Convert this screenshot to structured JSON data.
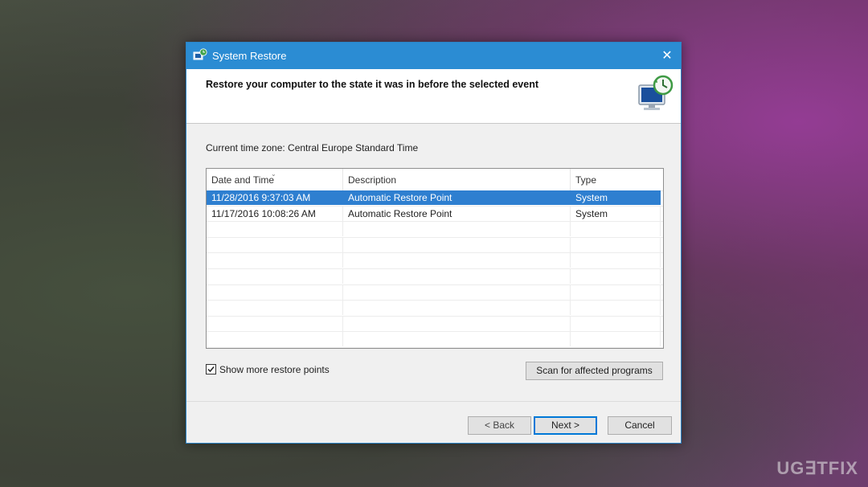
{
  "window": {
    "title": "System Restore",
    "close_glyph": "✕",
    "icon": "system-restore-icon"
  },
  "header": {
    "text": "Restore your computer to the state it was in before the selected event",
    "icon": "computer-restore-icon"
  },
  "timezone_label": "Current time zone: Central Europe Standard Time",
  "table": {
    "columns": [
      "Date and Time",
      "Description",
      "Type"
    ],
    "rows": [
      {
        "date": "11/28/2016 9:37:03 AM",
        "description": "Automatic Restore Point",
        "type": "System",
        "selected": true
      },
      {
        "date": "11/17/2016 10:08:26 AM",
        "description": "Automatic Restore Point",
        "type": "System",
        "selected": false
      }
    ]
  },
  "show_more": {
    "label": "Show more restore points",
    "checked": true
  },
  "buttons": {
    "scan": "Scan for affected programs",
    "back": "< Back",
    "next": "Next >",
    "cancel": "Cancel"
  },
  "watermark": "UG∃TFIX",
  "colors": {
    "titlebar": "#2b8cd3",
    "selection": "#2e7fd0"
  }
}
